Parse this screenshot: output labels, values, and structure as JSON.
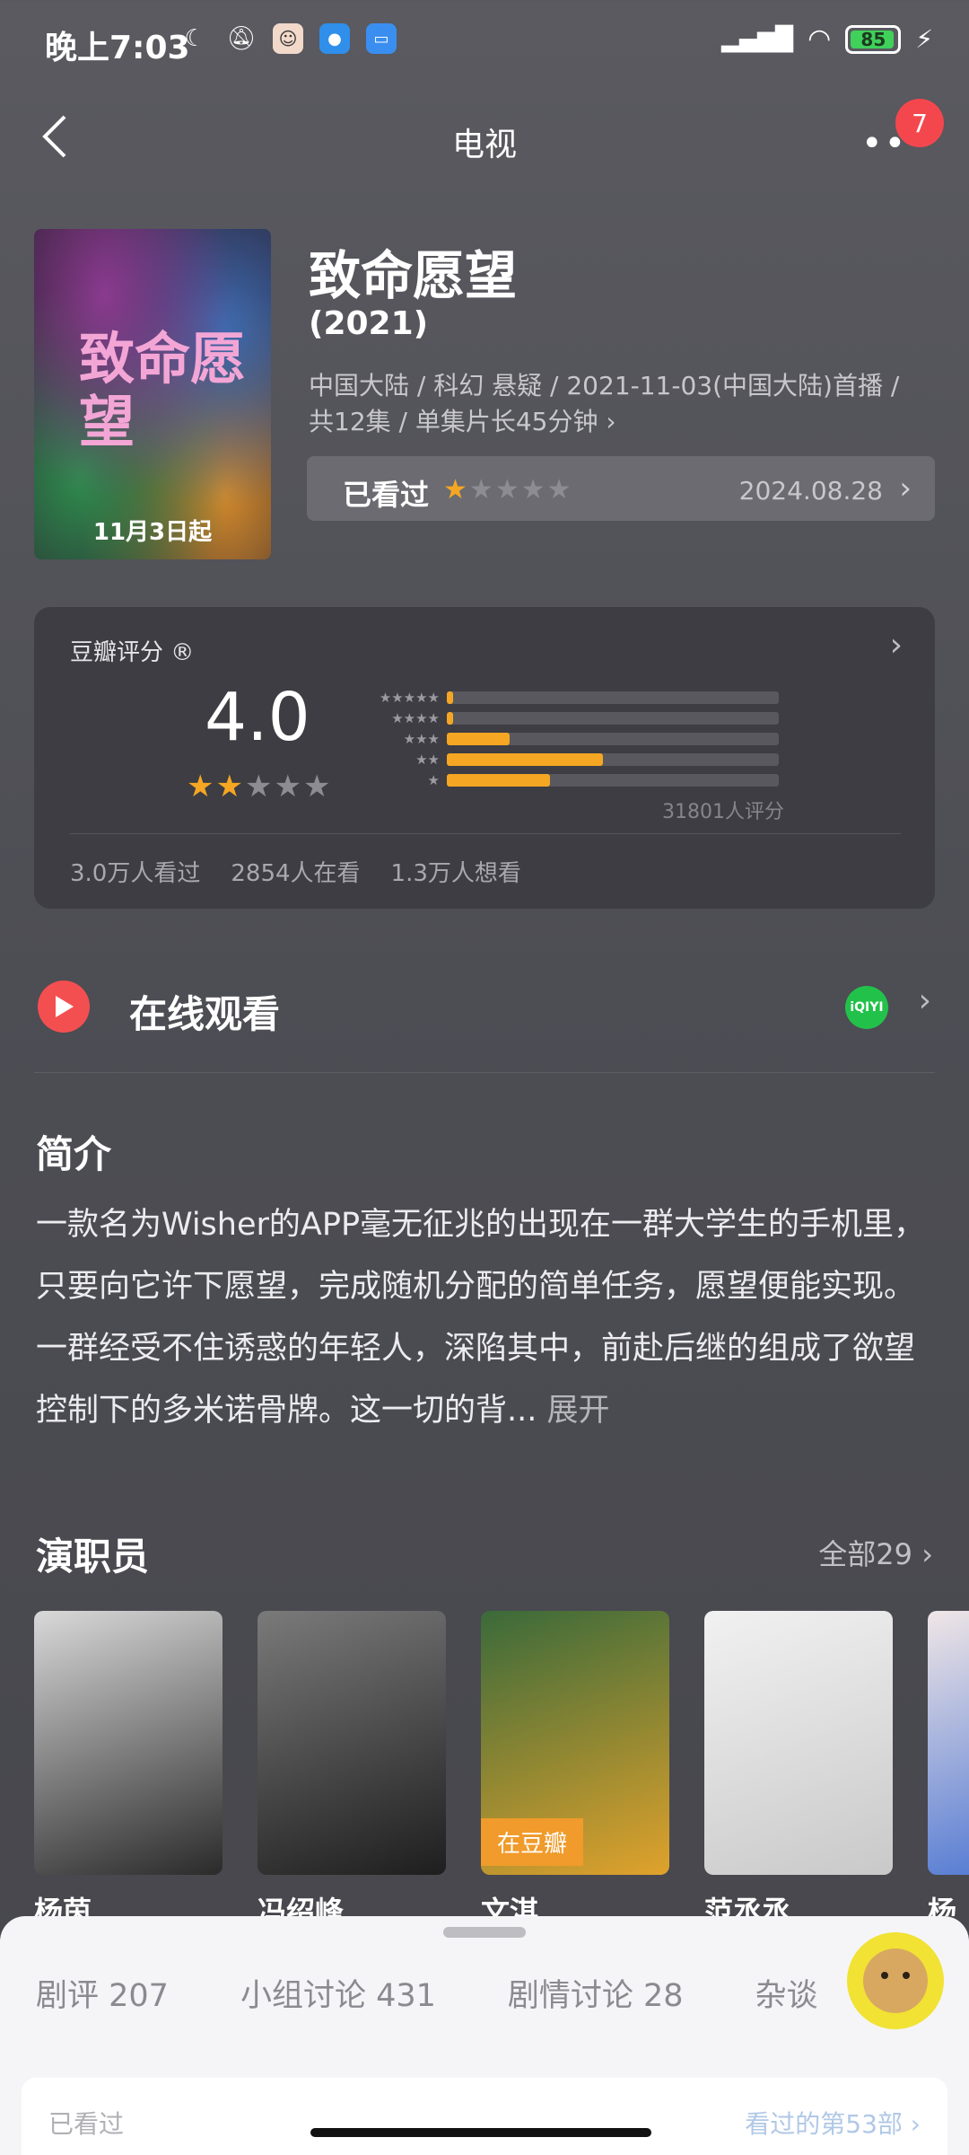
{
  "status_bar": {
    "time": "晚上7:03",
    "battery": "85"
  },
  "nav": {
    "title": "电视",
    "badge": "7"
  },
  "poster": {
    "title": "致命愿望",
    "date_text": "11月3日起"
  },
  "header": {
    "title": "致命愿望",
    "year": "(2021)",
    "meta_line1": "中国大陆 / 科幻 悬疑 / 2021-11-03(中国大陆)首播 /",
    "meta_line2": "共12集 / 单集片长45分钟 ›",
    "watched_label": "已看过",
    "watched_stars": 1,
    "watched_date": "2024.08.28"
  },
  "rating": {
    "label": "豆瓣评分 ®",
    "score": "4.0",
    "stars": 2,
    "distribution": [
      {
        "stars": "★★★★★",
        "fraction": 0.02
      },
      {
        "stars": "★★★★",
        "fraction": 0.02
      },
      {
        "stars": "★★★",
        "fraction": 0.19
      },
      {
        "stars": "★★",
        "fraction": 0.47
      },
      {
        "stars": "★",
        "fraction": 0.31
      }
    ],
    "count": "31801人评分",
    "stats": [
      "3.0万人看过",
      "2854人在看",
      "1.3万人想看"
    ]
  },
  "online": {
    "label": "在线观看",
    "provider": "iQIYI"
  },
  "intro": {
    "heading": "简介",
    "text": "一款名为Wisher的APP毫无征兆的出现在一群大学生的手机里，只要向它许下愿望，完成随机分配的简单任务，愿望便能实现。一群经受不住诱惑的年轻人，深陷其中，前赴后继的组成了欲望控制下的多米诺骨牌。这一切的背...",
    "more": " 展开"
  },
  "cast": {
    "heading": "演职员",
    "all": "全部29 ›",
    "members": [
      {
        "name": "杨茵",
        "tag": "",
        "colors": [
          "#d9d9d9",
          "#2a2a2a"
        ]
      },
      {
        "name": "冯绍峰",
        "tag": "",
        "colors": [
          "#7a7a7a",
          "#1e1e1e"
        ]
      },
      {
        "name": "文淇",
        "tag": "在豆瓣",
        "colors": [
          "#3a6a3a",
          "#e0a22c"
        ]
      },
      {
        "name": "范丞丞",
        "tag": "",
        "colors": [
          "#f1f1f1",
          "#c9c9c9"
        ]
      },
      {
        "name": "杨",
        "tag": "",
        "colors": [
          "#f0e6e6",
          "#3c6ad0"
        ]
      }
    ]
  },
  "sheet": {
    "tabs": [
      "剧评 207",
      "小组讨论 431",
      "剧情讨论 28",
      "杂谈"
    ],
    "inner_left": "已看过",
    "inner_right": "看过的第53部 ›"
  }
}
